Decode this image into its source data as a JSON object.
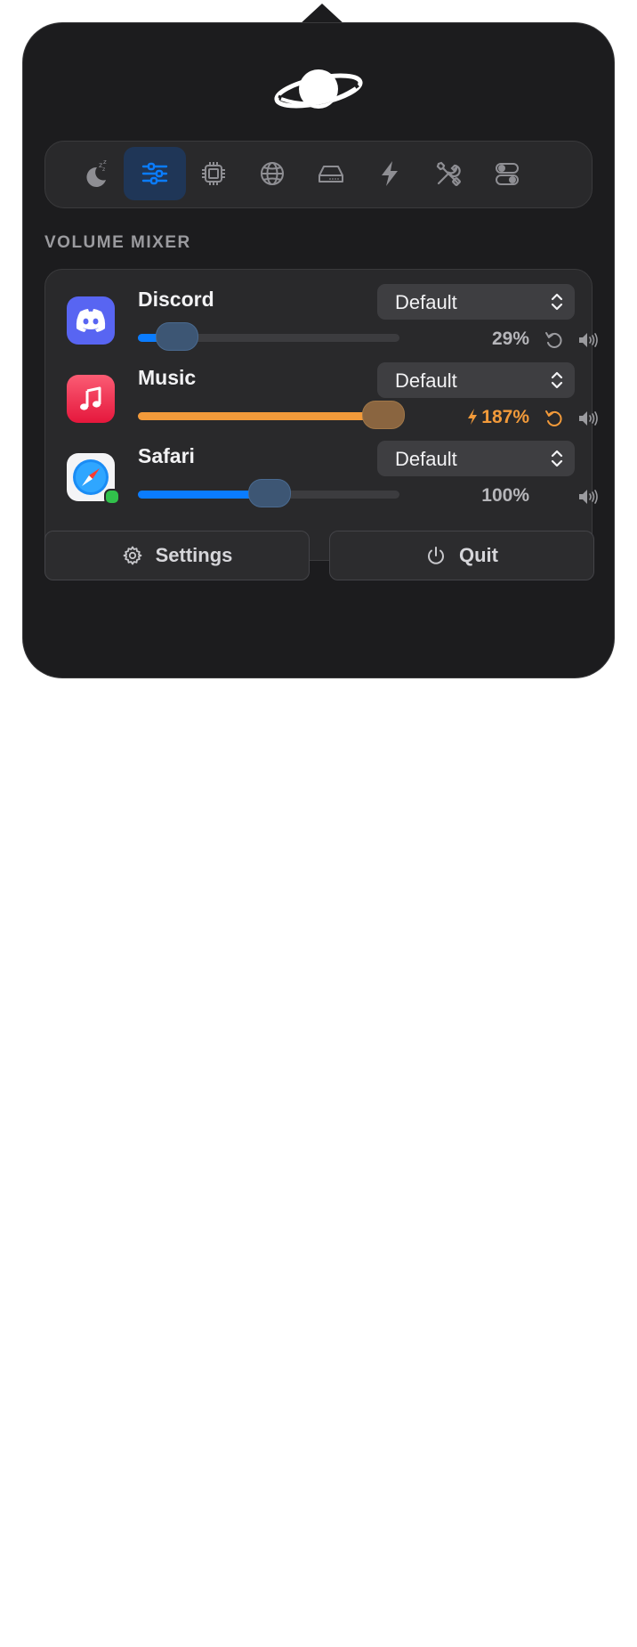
{
  "tabs": [
    {
      "name": "sleep",
      "icon": "moon-zzz-icon",
      "active": false
    },
    {
      "name": "mixer",
      "icon": "sliders-icon",
      "active": true
    },
    {
      "name": "cpu",
      "icon": "cpu-chip-icon",
      "active": false
    },
    {
      "name": "network",
      "icon": "globe-icon",
      "active": false
    },
    {
      "name": "disk",
      "icon": "drive-icon",
      "active": false
    },
    {
      "name": "power",
      "icon": "bolt-icon",
      "active": false
    },
    {
      "name": "tools",
      "icon": "tools-icon",
      "active": false
    },
    {
      "name": "toggles",
      "icon": "toggles-icon",
      "active": false
    }
  ],
  "section_title": "VOLUME MIXER",
  "apps": [
    {
      "name": "Discord",
      "output": "Default",
      "volume_percent": 29,
      "volume_label": "29%",
      "boosted": false,
      "show_reset": true,
      "color": "#0a7cff"
    },
    {
      "name": "Music",
      "output": "Default",
      "volume_percent": 187,
      "volume_label": "187%",
      "boosted": true,
      "show_reset": true,
      "color": "#f29a3a"
    },
    {
      "name": "Safari",
      "output": "Default",
      "volume_percent": 100,
      "volume_label": "100%",
      "boosted": false,
      "show_reset": false,
      "color": "#0a7cff"
    }
  ],
  "buttons": {
    "settings": "Settings",
    "quit": "Quit"
  },
  "colors": {
    "accent": "#0a7cff",
    "boost": "#f29a3a",
    "panel": "#1c1c1e"
  }
}
